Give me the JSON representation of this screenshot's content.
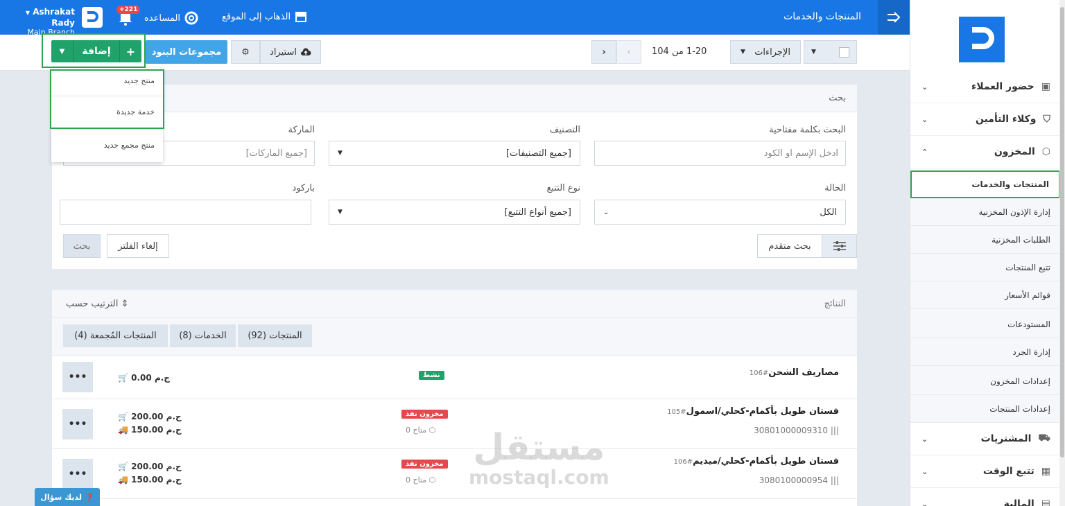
{
  "topbar": {
    "page_title": "المنتجات والخدمات",
    "goto_site": "الذهاب إلى الموقع",
    "help": "المساعده",
    "notif_count": "+221",
    "user_name": "Ashrakat Rady",
    "branch": "Main Branch"
  },
  "toolbar": {
    "add_label": "إضافة",
    "groups_label": "مجموعات البنود",
    "import_label": "استيراد",
    "pager_text": "1-20 من 104",
    "actions_label": "الإجراءات"
  },
  "add_menu": {
    "items": [
      "منتج جديد",
      "خدمة جديدة",
      "منتج مجمع جديد"
    ]
  },
  "search": {
    "title": "بحث",
    "keyword_label": "البحث بكلمة مفتاحية",
    "keyword_placeholder": "ادخل الإسم او الكود",
    "category_label": "التصنيف",
    "category_value": "[جميع التصنيفات]",
    "brand_label": "الماركة",
    "brand_placeholder": "[جميع الماركات]",
    "status_label": "الحالة",
    "status_value": "الكل",
    "tracking_label": "نوع التتبع",
    "tracking_value": "[جميع أنواع التتبع]",
    "barcode_label": "باركود",
    "advanced_label": "بحث متقدم",
    "clear_label": "إلغاء الفلتر",
    "search_label": "بحث"
  },
  "results": {
    "title": "النتائج",
    "sort_label": "الترتيب حسب",
    "tabs": [
      "المنتجات (92)",
      "الخدمات (8)",
      "المنتجات المُجمعة (4)"
    ],
    "rows": [
      {
        "name": "مصاريف الشحن",
        "id": "#106",
        "status": "نشط",
        "sell": "0.00 ج.م"
      },
      {
        "name": "فستان طويل بأكمام-كحلي/اسمول",
        "id": "#105",
        "code": "30801000009310",
        "status": "مخزون نفذ",
        "avail": "0 متاح",
        "sell": "200.00 ج.م",
        "buy": "150.00 ج.م"
      },
      {
        "name": "فستان طويل بأكمام-كحلي/ميديم",
        "id": "#106",
        "code": "3080100000954",
        "status": "مخزون نفذ",
        "avail": "0 متاح",
        "sell": "200.00 ج.م",
        "buy": "150.00 ج.م"
      }
    ]
  },
  "sidebar": {
    "items": [
      {
        "label": "حضور العملاء"
      },
      {
        "label": "وكلاء التأمين"
      },
      {
        "label": "المخزون"
      },
      {
        "label": "المشتريات"
      },
      {
        "label": "تتبع الوقت"
      },
      {
        "label": "المالية"
      }
    ],
    "sub_items": [
      "المنتجات والخدمات",
      "إدارة الإذون المخزنية",
      "الطلبات المخزنية",
      "تتبع المنتجات",
      "قوائم الأسعار",
      "المستودعات",
      "إدارة الجرد",
      "إعدادات المخزون",
      "إعدادات المنتجات"
    ]
  },
  "ask_label": "لديك سؤال",
  "watermark": {
    "ar": "مستقل",
    "en": "mostaql.com"
  },
  "colors": {
    "primary": "#1877e5",
    "add_green": "#22a26b",
    "active": "#2ea44f",
    "out_of_stock": "#e5484d"
  }
}
